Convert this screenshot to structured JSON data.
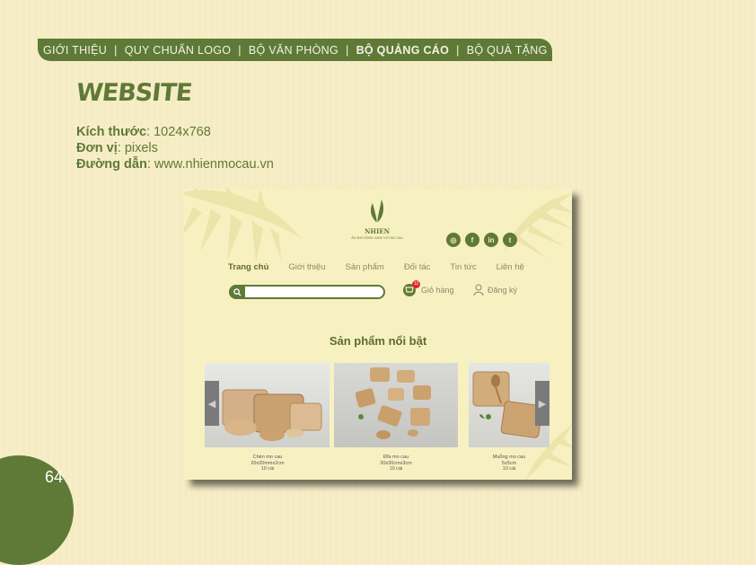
{
  "nav": {
    "items": [
      "GIỚI THIỆU",
      "QUY CHUẨN LOGO",
      "BỘ VĂN PHÒNG",
      "BỘ QUẢNG CÁO",
      "BỘ QUÀ TẶNG"
    ],
    "separator": "|",
    "active_index": 3
  },
  "section_title": "WEBSITE",
  "specs": {
    "size_label": "Kích thước",
    "size_value": ": 1024x768",
    "unit_label": "Đơn vị",
    "unit_value": ": pixels",
    "link_label": "Đường dẫn",
    "link_value": ": www.nhienmocau.vn"
  },
  "page_number": "64",
  "mockup": {
    "logo_name": "NHIEN",
    "logo_tagline": "ĂN ÁNH SỐNG XANH VỚI MO CAU",
    "social": [
      "instagram-icon",
      "facebook-icon",
      "linkedin-icon",
      "twitter-icon"
    ],
    "social_glyphs": [
      "◎",
      "f",
      "in",
      "t"
    ],
    "menu": [
      "Trang chủ",
      "Giới thiệu",
      "Sản phẩm",
      "Đối tác",
      "Tin tức",
      "Liên hệ"
    ],
    "cart_label": "Giỏ hàng",
    "cart_count": "12",
    "signup_label": "Đăng ký",
    "featured_title": "Sản phẩm nổi bật",
    "products": [
      {
        "name": "Chén mo cau",
        "size": "20x20mmx2cm",
        "qty": "10 cái"
      },
      {
        "name": "Đĩa mo cau",
        "size": "30x30cmx3cm",
        "qty": "10 cái"
      },
      {
        "name": "Muỗng mo cau",
        "size": "5x5cm",
        "qty": "10 cái"
      }
    ]
  },
  "colors": {
    "brand_green": "#5f7a36",
    "background": "#f6ecc4",
    "mockup_bg": "#f7f1c2"
  }
}
